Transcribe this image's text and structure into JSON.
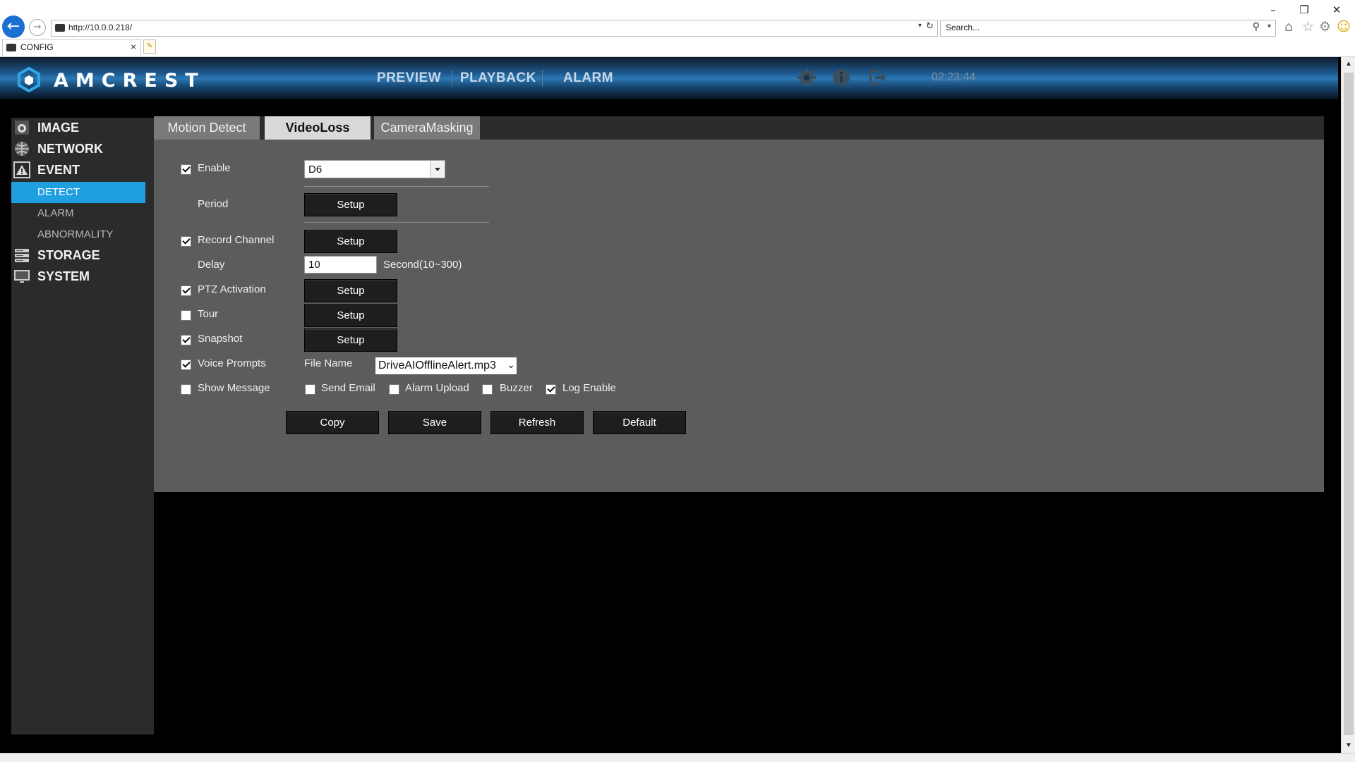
{
  "browser": {
    "url": "http://10.0.0.218/",
    "search_placeholder": "Search...",
    "tab_title": "CONFIG",
    "tab_close": "×",
    "back_icon": "arrow-left-icon",
    "forward_icon": "arrow-right-icon",
    "window": {
      "minimize": "–",
      "restore": "❐",
      "close": "✕"
    },
    "toolbar_icons": [
      "home-icon",
      "star-icon",
      "gear-icon",
      "smiley-icon"
    ]
  },
  "header": {
    "logo_text": "AMCREST",
    "nav": [
      "PREVIEW",
      "PLAYBACK",
      "ALARM"
    ],
    "clock": "02:23:44",
    "icons": [
      "settings-gear-icon",
      "info-icon",
      "logout-icon"
    ]
  },
  "sidebar": {
    "items": [
      {
        "label": "IMAGE",
        "icon": "camera-icon"
      },
      {
        "label": "NETWORK",
        "icon": "globe-icon"
      },
      {
        "label": "EVENT",
        "icon": "warning-icon"
      },
      {
        "label": "DETECT",
        "active": true
      },
      {
        "label": "ALARM"
      },
      {
        "label": "ABNORMALITY"
      },
      {
        "label": "STORAGE",
        "icon": "storage-icon"
      },
      {
        "label": "SYSTEM",
        "icon": "monitor-icon"
      }
    ]
  },
  "tabs": [
    {
      "label": "Motion Detect"
    },
    {
      "label": "VideoLoss",
      "active": true
    },
    {
      "label": "CameraMasking"
    }
  ],
  "form": {
    "enable": {
      "label": "Enable",
      "checked": true
    },
    "channel": "D6",
    "period": {
      "label": "Period",
      "button": "Setup"
    },
    "record_channel": {
      "label": "Record Channel",
      "checked": true,
      "button": "Setup"
    },
    "delay": {
      "label": "Delay",
      "value": "10",
      "unit": "Second(10~300)"
    },
    "ptz": {
      "label": "PTZ Activation",
      "checked": true,
      "button": "Setup"
    },
    "tour": {
      "label": "Tour",
      "checked": false,
      "button": "Setup"
    },
    "snapshot": {
      "label": "Snapshot",
      "checked": true,
      "button": "Setup"
    },
    "voice": {
      "label": "Voice Prompts",
      "checked": true,
      "file_label": "File Name",
      "file_value": "DriveAIOfflineAlert.mp3"
    },
    "show_message": {
      "label": "Show Message",
      "checked": false
    },
    "send_email": {
      "label": "Send Email",
      "checked": false
    },
    "alarm_upload": {
      "label": "Alarm Upload",
      "checked": false
    },
    "buzzer": {
      "label": "Buzzer",
      "checked": false
    },
    "log_enable": {
      "label": "Log Enable",
      "checked": true
    }
  },
  "actions": {
    "copy": "Copy",
    "save": "Save",
    "refresh": "Refresh",
    "default": "Default"
  },
  "colors": {
    "accent": "#1f9fe0",
    "panel": "#5c5c5c",
    "sidebar": "#2b2b2b"
  }
}
